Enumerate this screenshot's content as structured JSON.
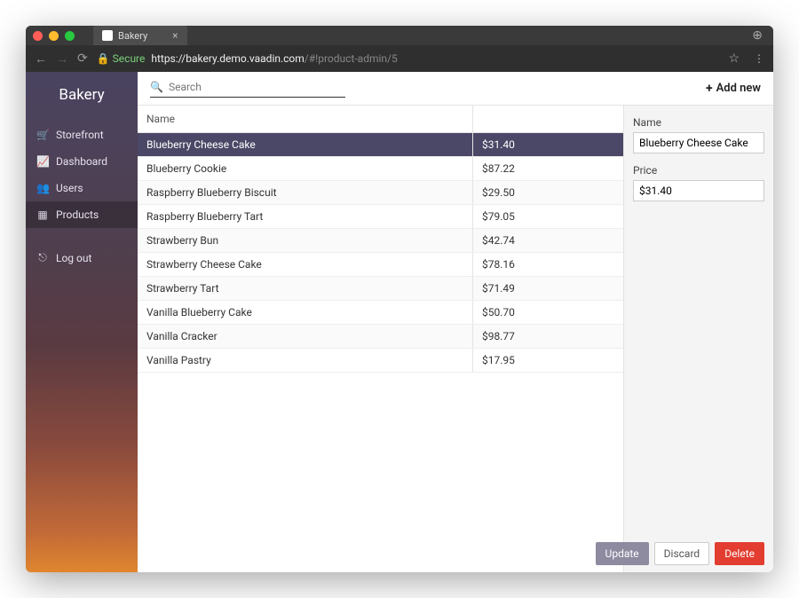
{
  "browser": {
    "tab_title": "Bakery",
    "secure_label": "Secure",
    "url_host": "https://bakery.demo.vaadin.com",
    "url_path": "/#!product-admin/5"
  },
  "app": {
    "brand": "Bakery",
    "nav": {
      "storefront": "Storefront",
      "dashboard": "Dashboard",
      "users": "Users",
      "products": "Products",
      "logout": "Log out"
    },
    "search_placeholder": "Search",
    "add_new_label": "Add new",
    "columns": {
      "name": "Name",
      "price": ""
    },
    "products": [
      {
        "name": "Blueberry Cheese Cake",
        "price": "$31.40",
        "selected": true
      },
      {
        "name": "Blueberry Cookie",
        "price": "$87.22"
      },
      {
        "name": "Raspberry Blueberry Biscuit",
        "price": "$29.50"
      },
      {
        "name": "Raspberry Blueberry Tart",
        "price": "$79.05"
      },
      {
        "name": "Strawberry Bun",
        "price": "$42.74"
      },
      {
        "name": "Strawberry Cheese Cake",
        "price": "$78.16"
      },
      {
        "name": "Strawberry Tart",
        "price": "$71.49"
      },
      {
        "name": "Vanilla Blueberry Cake",
        "price": "$50.70"
      },
      {
        "name": "Vanilla Cracker",
        "price": "$98.77"
      },
      {
        "name": "Vanilla Pastry",
        "price": "$17.95"
      }
    ],
    "detail": {
      "name_label": "Name",
      "name_value": "Blueberry Cheese Cake",
      "price_label": "Price",
      "price_value": "$31.40",
      "update": "Update",
      "discard": "Discard",
      "delete": "Delete"
    }
  }
}
